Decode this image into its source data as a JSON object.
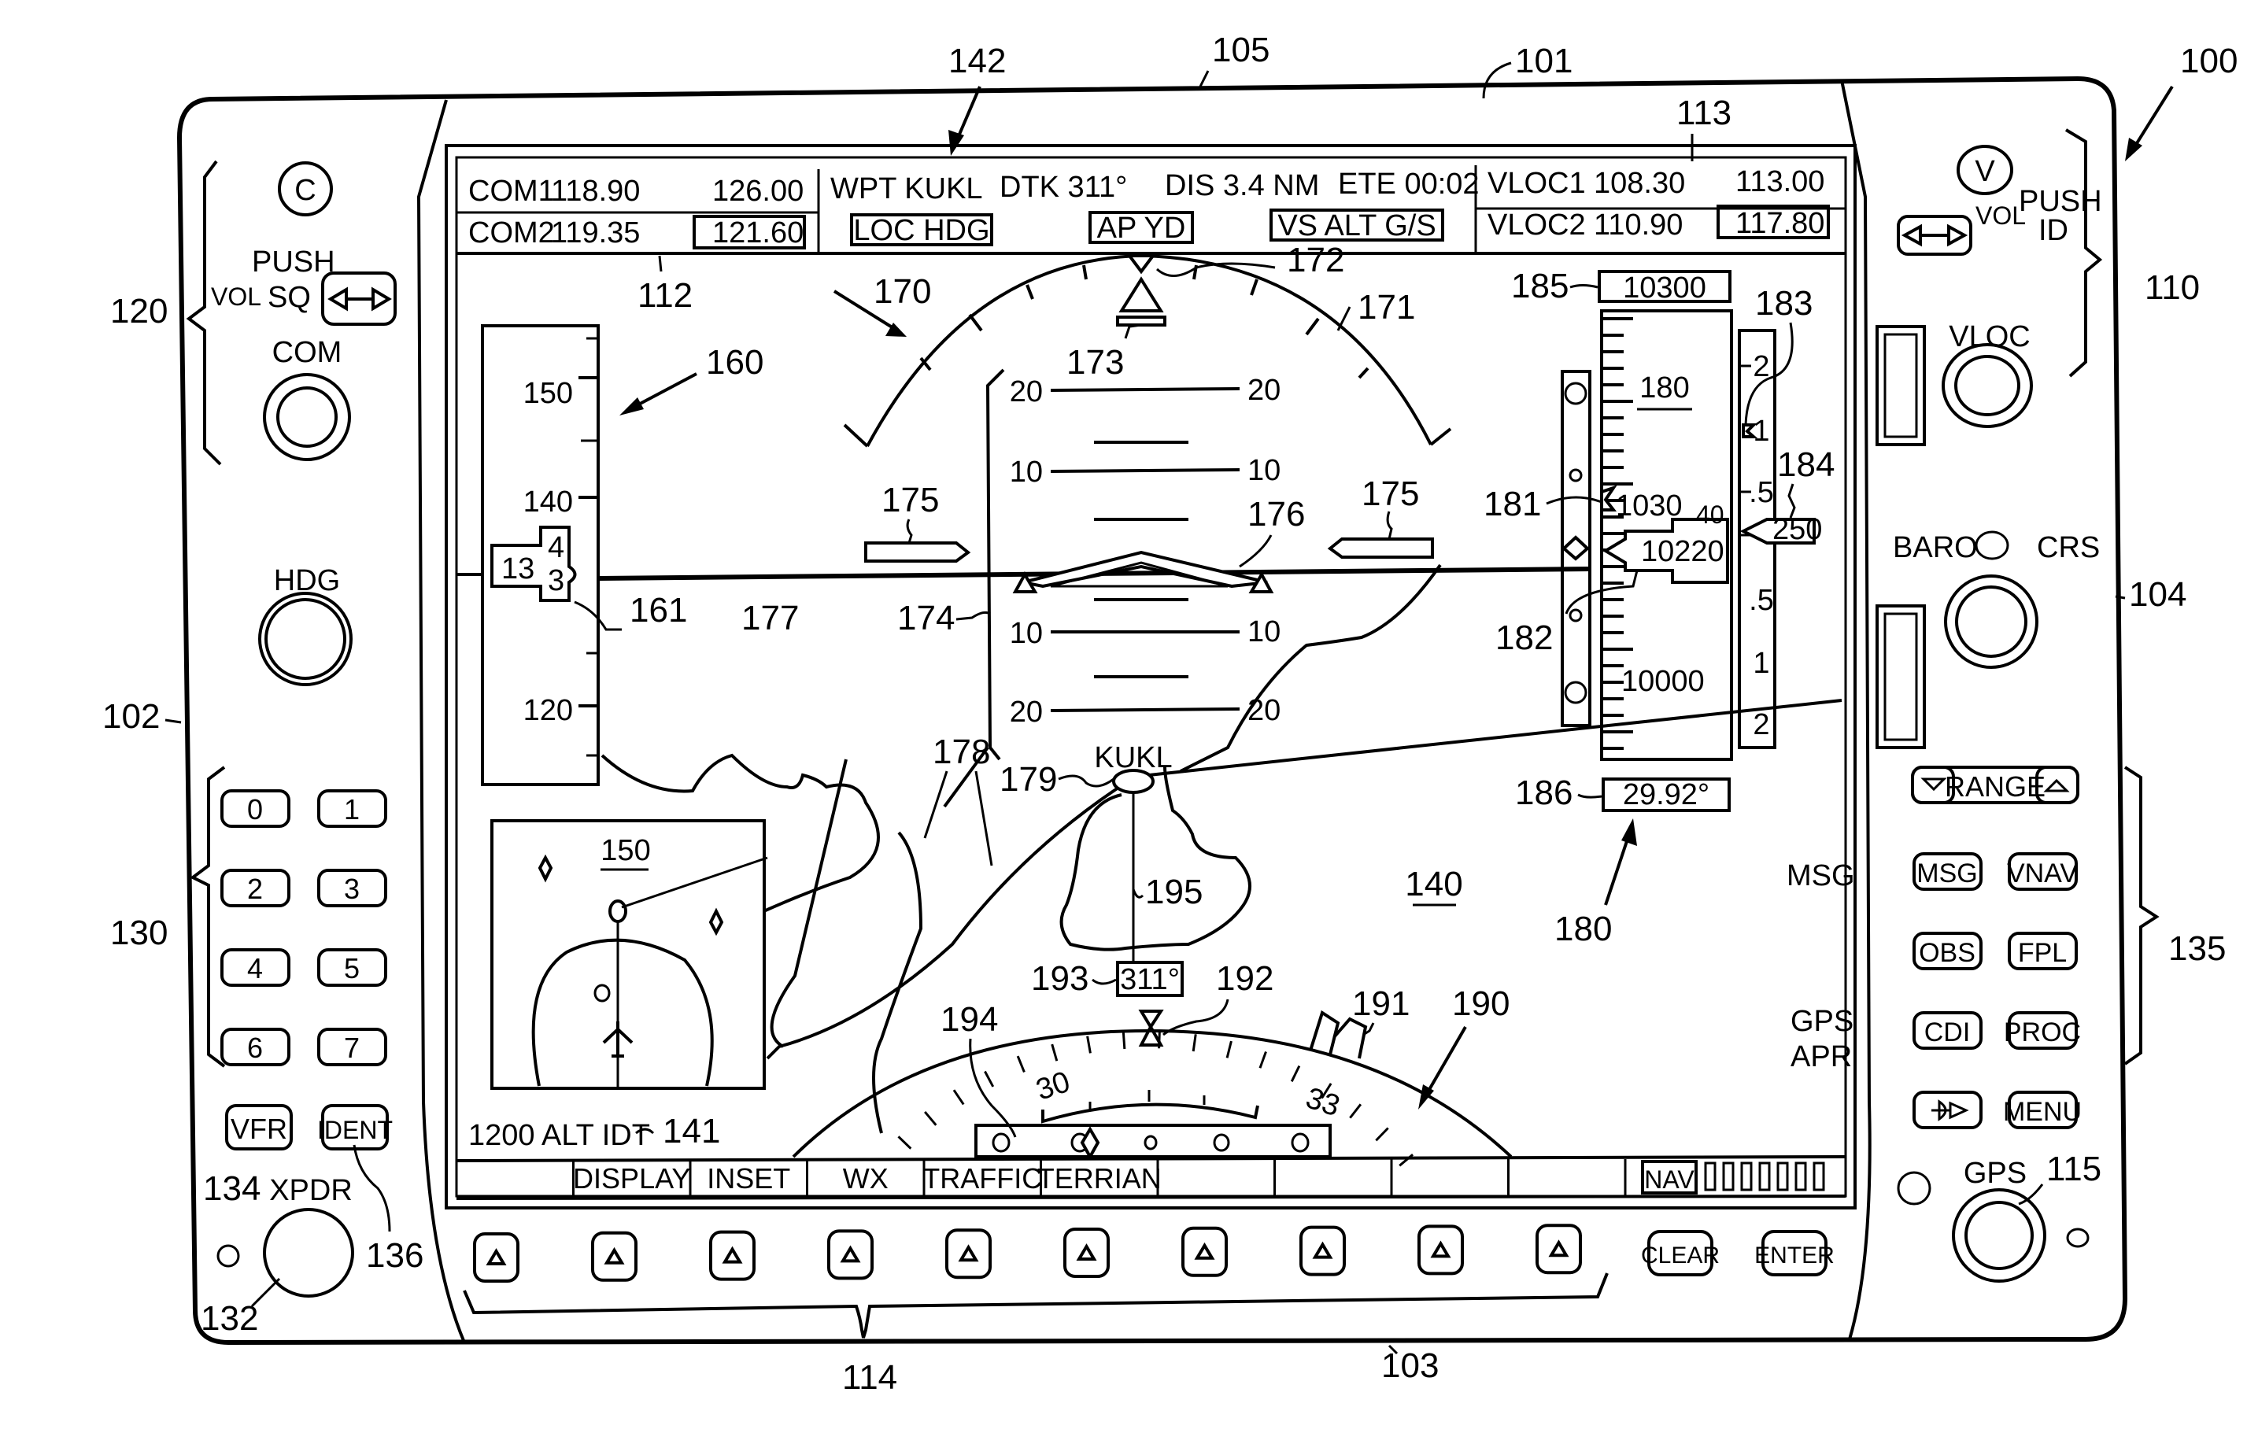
{
  "device": {
    "ref_labels": {
      "device": "100",
      "bezel_top": "101",
      "bezel_left": "102",
      "bezel_bottom": "103",
      "bezel_right": "104",
      "screen": "105",
      "com_controls": "120",
      "vloc_controls": "110",
      "keypad": "130",
      "right_keys": "135",
      "softkeys": "114",
      "gps_knob": "115",
      "xpdr_knob": "132",
      "vfr_key": "134",
      "ident_key": "136",
      "display_data": "142",
      "com_field": "112",
      "vloc_field": "113",
      "map": "140",
      "xpdr_status": "141",
      "inset": "150",
      "airspeed": "160",
      "airspeed_pointer": "161",
      "attitude": "170",
      "roll_scale": "171",
      "roll_pointer": "172",
      "slip_indicator": "173",
      "pitch_scale": "174",
      "fd_cues": "175",
      "aircraft_symbol": "176",
      "horizon": "177",
      "terrain": "178",
      "waypoint": "179",
      "altimeter": "180",
      "alt_bug": "181",
      "alt_pointer": "182",
      "vsi_bug": "183",
      "vsi_readout": "184",
      "alt_select": "185",
      "baro": "186",
      "hsi": "190",
      "heading_bug": "191",
      "heading_pointer": "192",
      "heading_readout": "193",
      "cdi": "194",
      "course_line": "195"
    }
  },
  "left_panel": {
    "com_badge": "C",
    "vol_label": "VOL",
    "push_label": "PUSH",
    "sq_label": "SQ",
    "com_knob_label": "COM",
    "hdg_knob_label": "HDG",
    "keypad": [
      "0",
      "1",
      "2",
      "3",
      "4",
      "5",
      "6",
      "7"
    ],
    "vfr_label": "VFR",
    "ident_label": "IDENT",
    "xpdr_label": "XPDR"
  },
  "right_panel": {
    "vloc_badge": "V",
    "vol_label": "VOL",
    "push_label": "PUSH",
    "id_label": "ID",
    "vloc_knob_label": "VLOC",
    "baro_label": "BARO",
    "crs_label": "CRS",
    "range_label": "RANGE",
    "keys": [
      "MSG",
      "VNAV",
      "OBS",
      "FPL",
      "CDI",
      "PROC",
      "D→",
      "MENU"
    ],
    "gps_knob_label": "GPS"
  },
  "top_bar": {
    "com1_label": "COM1",
    "com1_active": "118.90",
    "com1_standby": "126.00",
    "com2_label": "COM2",
    "com2_active": "119.35",
    "com2_standby": "121.60",
    "wpt": "WPT  KUKL",
    "dtk": "DTK  311°",
    "dis": "DIS  3.4  NM",
    "ete": "ETE  00:02",
    "mode_lateral": "LOC  HDG",
    "mode_ap": "AP  YD",
    "mode_vertical": "VS  ALT  G/S",
    "vloc1_label": "VLOC1",
    "vloc1_active": "108.30",
    "vloc1_standby": "113.00",
    "vloc2_label": "VLOC2",
    "vloc2_active": "110.90",
    "vloc2_standby": "117.80"
  },
  "pfd": {
    "airspeed_ticks": [
      "150",
      "140",
      "120"
    ],
    "airspeed_readout_tens": "13",
    "airspeed_readout_upper": "4",
    "airspeed_readout_lower": "3",
    "pitch_ticks": [
      "20",
      "10",
      "10",
      "20"
    ],
    "altitude_select": "10300",
    "altitude_ticks": [
      "10000"
    ],
    "altitude_bug_value": "1030",
    "altitude_readout": "10220",
    "altitude_readout_next": "40",
    "altitude_tape_label": "180",
    "baro_setting": "29.92°",
    "vsi_ticks": [
      "2",
      "1",
      ".5",
      ".5",
      "1",
      "2"
    ],
    "vsi_readout": "250"
  },
  "map": {
    "waypoint": "KUKL",
    "map_label": "140",
    "msg_annunciation": "MSG",
    "gps_annunciation": "GPS",
    "apr_annunciation": "APR",
    "heading_readout": "311°",
    "hsi_ticks": [
      "30",
      "33"
    ],
    "inset_label": "150",
    "xpdr_status": "1200  ALT  IDT"
  },
  "softkey_bar": {
    "labels": [
      "",
      "DISPLAY",
      "INSET",
      "WX",
      "TRAFFIC",
      "TERRIAN",
      "",
      "",
      "",
      ""
    ],
    "nav_label": "NAV"
  },
  "bottom_keys": {
    "softkey_count": 10,
    "clear_label": "CLEAR",
    "enter_label": "ENTER"
  }
}
